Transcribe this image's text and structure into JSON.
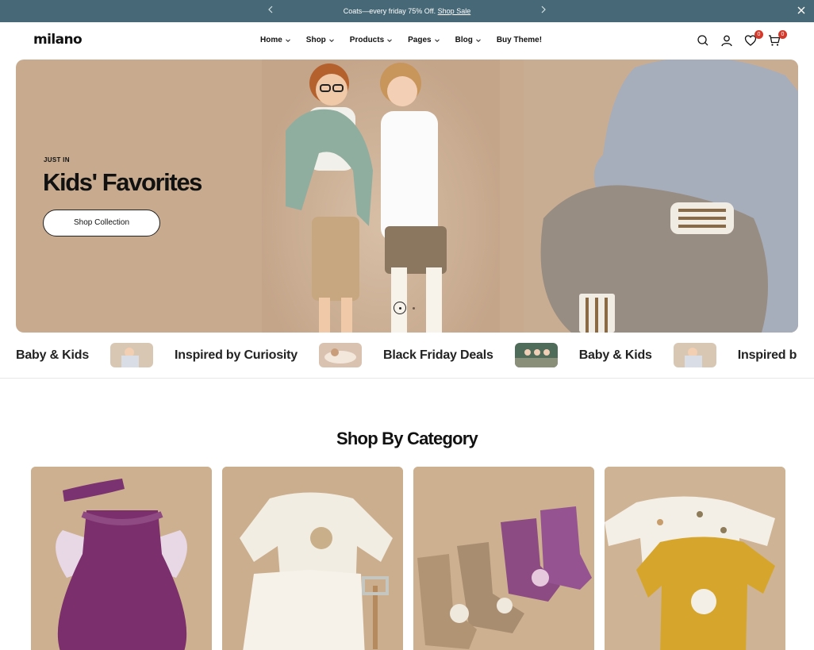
{
  "announcement": {
    "message": "Coats—every friday 75% Off.",
    "link_label": "Shop Sale",
    "prev_icon": "chevron-left-icon",
    "next_icon": "chevron-right-icon",
    "close_icon": "close-icon",
    "bg_color": "#476876"
  },
  "header": {
    "logo": "milano",
    "nav": [
      {
        "label": "Home",
        "has_dropdown": true
      },
      {
        "label": "Shop",
        "has_dropdown": true
      },
      {
        "label": "Products",
        "has_dropdown": true
      },
      {
        "label": "Pages",
        "has_dropdown": true
      },
      {
        "label": "Blog",
        "has_dropdown": true
      },
      {
        "label": "Buy Theme!",
        "has_dropdown": false
      }
    ],
    "icons": {
      "search": "search-icon",
      "account": "user-icon",
      "wishlist": "heart-icon",
      "cart": "cart-icon"
    },
    "wishlist_count": "0",
    "cart_count": "0",
    "badge_color": "#d33a2c"
  },
  "hero": {
    "eyebrow": "JUST IN",
    "title": "Kids' Favorites",
    "cta_label": "Shop Collection",
    "bg_color": "#c8ab8f",
    "slide_index": 1,
    "slide_count": 2
  },
  "marquee": {
    "items": [
      "Baby & Kids",
      "Inspired by Curiosity",
      "Black Friday Deals",
      "Baby & Kids",
      "Inspired b"
    ]
  },
  "category_section": {
    "title": "Shop By Category",
    "cards": [
      {
        "image": "purple-dress-photo"
      },
      {
        "image": "quilted-set-photo"
      },
      {
        "image": "knit-booties-photo"
      },
      {
        "image": "animal-print-tops-photo"
      }
    ]
  }
}
